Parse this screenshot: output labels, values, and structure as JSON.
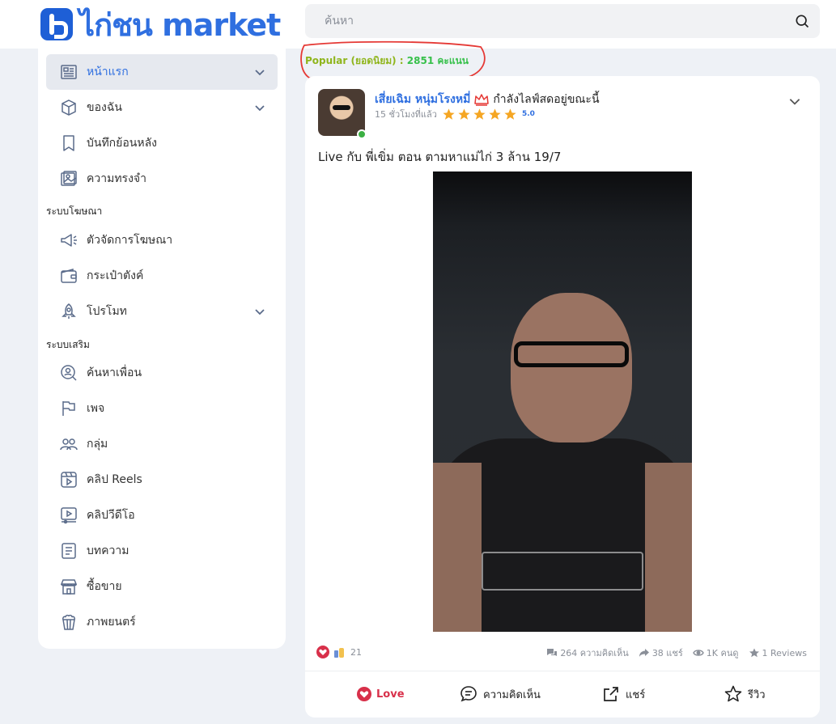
{
  "header": {
    "logo_text": "ไก่ชน market",
    "search_placeholder": "ค้นหา",
    "search_value": ""
  },
  "sidebar": {
    "items": [
      {
        "label": "หน้าแรก",
        "icon": "newspaper-icon",
        "active": true,
        "has_chevron": true
      },
      {
        "label": "ของฉัน",
        "icon": "box-icon",
        "has_chevron": true
      },
      {
        "label": "บันทึกย้อนหลัง",
        "icon": "bookmark-icon"
      },
      {
        "label": "ความทรงจำ",
        "icon": "photo-album-icon"
      }
    ],
    "section_ads": "ระบบโฆษณา",
    "ads_items": [
      {
        "label": "ตัวจัดการโฆษณา",
        "icon": "megaphone-icon"
      },
      {
        "label": "กระเป๋าตังค์",
        "icon": "wallet-icon"
      },
      {
        "label": "โปรโมท",
        "icon": "rocket-icon",
        "has_chevron": true
      }
    ],
    "section_extra": "ระบบเสริม",
    "extra_items": [
      {
        "label": "ค้นหาเพื่อน",
        "icon": "find-friend-icon"
      },
      {
        "label": "เพจ",
        "icon": "flag-icon"
      },
      {
        "label": "กลุ่ม",
        "icon": "group-icon"
      },
      {
        "label": "คลิป Reels",
        "icon": "reels-icon"
      },
      {
        "label": "คลิปวีดีโอ",
        "icon": "video-icon"
      },
      {
        "label": "บทความ",
        "icon": "article-icon"
      },
      {
        "label": "ซื้อขาย",
        "icon": "shop-icon"
      },
      {
        "label": "ภาพยนตร์",
        "icon": "popcorn-icon"
      }
    ]
  },
  "popular": {
    "label": "Popular (ยอดนิยม) :",
    "points": "2851 คะแนน"
  },
  "post": {
    "author": "เสี่ยเฉิม หนุ่มโรงหมี่",
    "status": "กำลังไลฟ์สดอยู่ขณะนี้",
    "time": "15 ชั่วโมงที่แล้ว",
    "stars": 5,
    "rating": "5.0",
    "caption": "Live กับ พี่เขิ่ม ตอน ตามหาแม่ไก่ 3 ล้าน 19/7",
    "reaction_count": "21",
    "comments": "264 ความคิดเห็น",
    "shares": "38 แชร์",
    "views": "1K คนดู",
    "reviews": "1 Reviews",
    "actions": {
      "love": "Love",
      "comment": "ความคิดเห็น",
      "share": "แชร์",
      "review": "รีวิว"
    }
  },
  "colors": {
    "brand": "#2f6fe0",
    "popular_label": "#8fb51c",
    "popular_points": "#36c04a",
    "star": "#f5a623",
    "love": "#d8304a",
    "highlight_circle": "#e53935"
  }
}
